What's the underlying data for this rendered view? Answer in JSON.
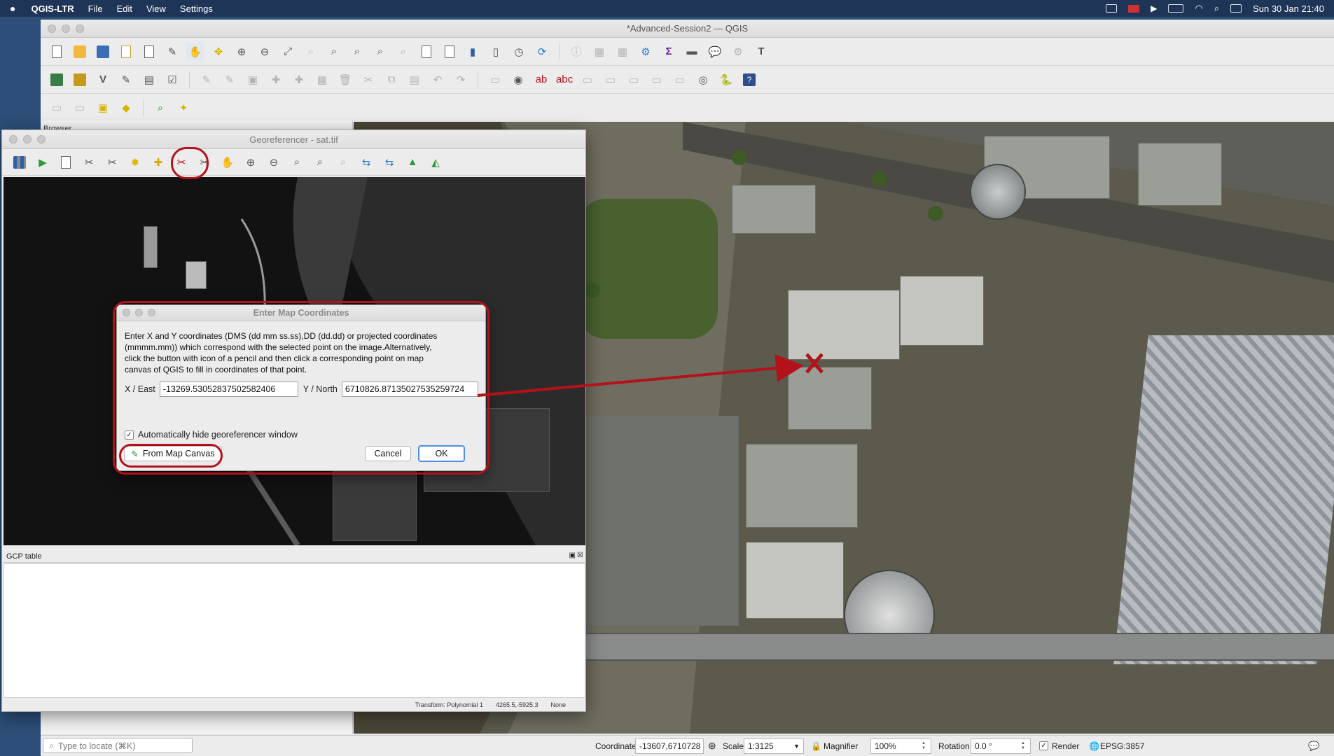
{
  "menubar": {
    "app_name": "QGIS-LTR",
    "items": [
      "File",
      "Edit",
      "View",
      "Settings"
    ],
    "clock": "Sun 30 Jan  21:40"
  },
  "qgis": {
    "window_title": "*Advanced-Session2 — QGIS",
    "browser_panel_title": "Browser"
  },
  "georeferencer": {
    "window_title": "Georeferencer - sat.tif",
    "gcp_table_title": "GCP table",
    "status": {
      "transform": "Transform: Polynomial 1",
      "coords": "4265.5,-5925.3",
      "residual": "None"
    }
  },
  "dialog": {
    "title": "Enter Map Coordinates",
    "message_lines": [
      "Enter X and Y coordinates (DMS (dd mm ss.ss),DD (dd.dd) or projected coordinates",
      "(mmmm.mm)) which correspond with the selected point on the image.Alternatively,",
      "click the button with icon of a pencil and then click a corresponding point on map",
      "canvas of QGIS to fill in coordinates of that point."
    ],
    "x_label": "X / East",
    "x_value": "-13269.53052837502582406",
    "y_label": "Y / North",
    "y_value": "6710826.87135027535259724",
    "autohide_label": "Automatically hide georeferencer window",
    "autohide_checked": true,
    "from_map_canvas_label": "From Map Canvas",
    "cancel_label": "Cancel",
    "ok_label": "OK"
  },
  "statusbar": {
    "locate_placeholder": "Type to locate (⌘K)",
    "coordinate_label": "Coordinate",
    "coordinate_value": "-13607,6710728",
    "scale_label": "Scale",
    "scale_value": "1:3125",
    "magnifier_label": "Magnifier",
    "magnifier_value": "100%",
    "rotation_label": "Rotation",
    "rotation_value": "0.0 °",
    "render_label": "Render",
    "render_checked": true,
    "crs": "EPSG:3857"
  },
  "colors": {
    "annotation_red": "#b3121b",
    "menubar_bg": "#1f3557",
    "default_button_border": "#4f8ee0"
  }
}
